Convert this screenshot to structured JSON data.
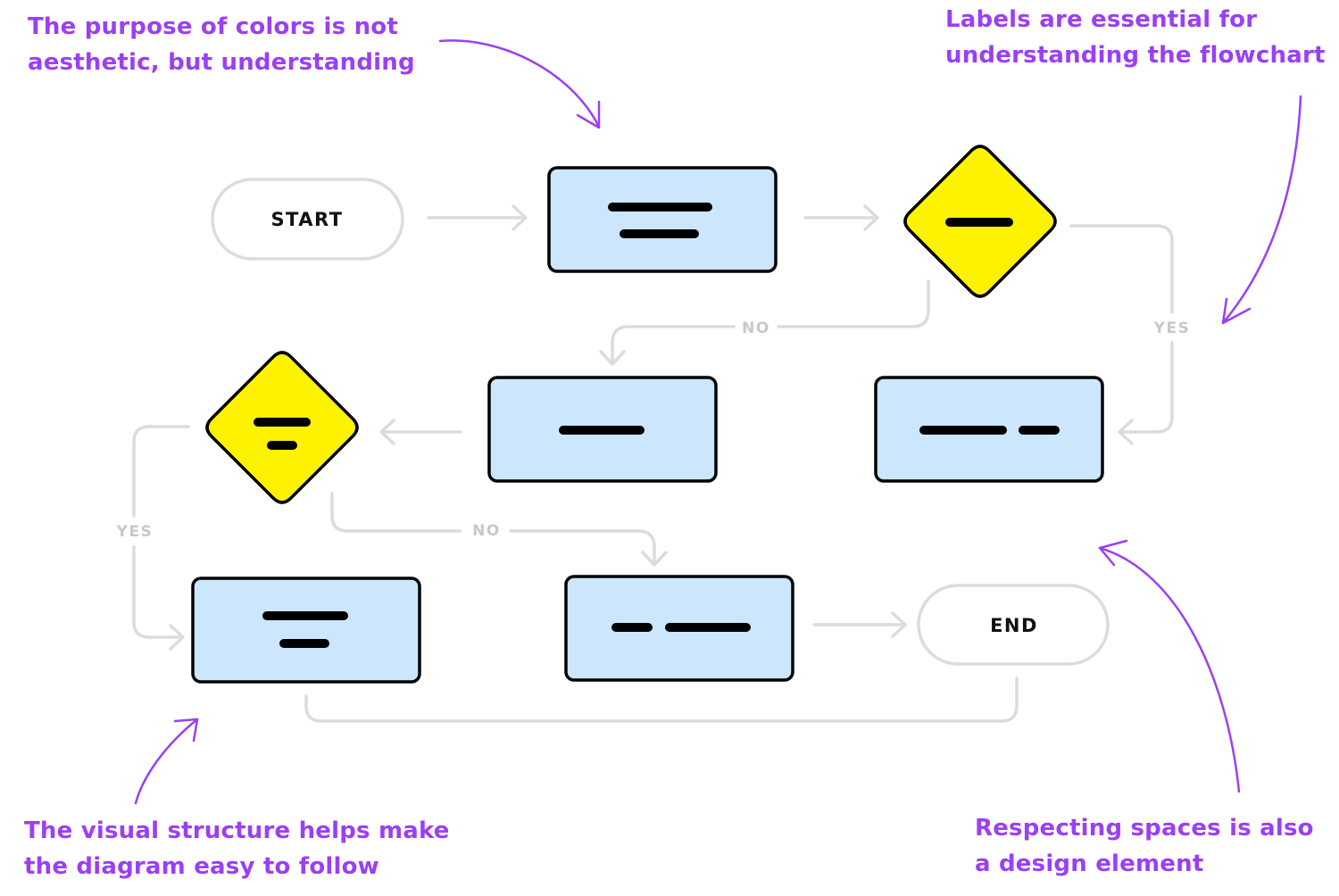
{
  "colors": {
    "accent": "#9b3ff5",
    "process_fill": "#cce7fd",
    "decision_fill": "#fdf200",
    "outline": "#000000",
    "connector": "#dcdcdc",
    "edge_label": "#c8c8c8",
    "terminal_border": "#dcdcdc"
  },
  "annotations": {
    "colors_note": [
      "The purpose of colors is not",
      "aesthetic, but understanding"
    ],
    "labels_note": [
      "Labels are essential for",
      "understanding the flowchart"
    ],
    "structure_note": [
      "The visual structure helps make",
      "the diagram easy to follow"
    ],
    "spaces_note": [
      "Respecting spaces is also",
      "a design element"
    ]
  },
  "flowchart": {
    "start_label": "START",
    "end_label": "END",
    "edge_labels": {
      "decision1_no": "NO",
      "decision1_yes": "YES",
      "decision2_yes": "YES",
      "decision2_no": "NO"
    },
    "nodes": [
      {
        "id": "start",
        "type": "terminal"
      },
      {
        "id": "process1",
        "type": "process",
        "placeholder_lines": "two stacked lines"
      },
      {
        "id": "decision1",
        "type": "decision",
        "placeholder_lines": "one line"
      },
      {
        "id": "process2",
        "type": "process",
        "placeholder_lines": "one line"
      },
      {
        "id": "process3",
        "type": "process",
        "placeholder_lines": "long + short line"
      },
      {
        "id": "decision2",
        "type": "decision",
        "placeholder_lines": "two stacked lines"
      },
      {
        "id": "process4",
        "type": "process",
        "placeholder_lines": "two stacked lines"
      },
      {
        "id": "process5",
        "type": "process",
        "placeholder_lines": "short + long line"
      },
      {
        "id": "end",
        "type": "terminal"
      }
    ]
  }
}
